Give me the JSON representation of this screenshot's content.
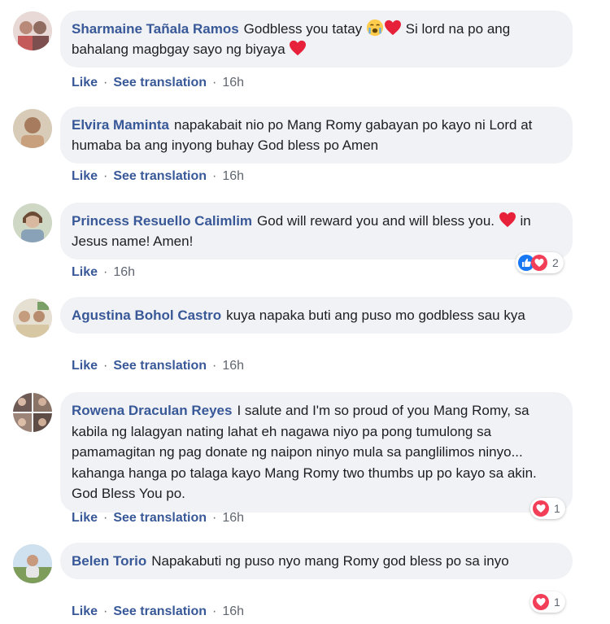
{
  "comments": [
    {
      "author": "Sharmaine Tañala Ramos",
      "text_parts": [
        "Godbless you tatay ",
        " Si lord na po ang bahalang magbgay sayo ng biyaya "
      ],
      "actions": {
        "like": "Like",
        "translate": "See translation",
        "time": "16h"
      }
    },
    {
      "author": "Elvira Maminta",
      "text": "napakabait nio po Mang Romy gabayan po kayo ni Lord at humaba ba ang inyong buhay God bless po Amen",
      "actions": {
        "like": "Like",
        "translate": "See translation",
        "time": "16h"
      }
    },
    {
      "author": "Princess Resuello Calimlim",
      "text_parts": [
        "God will reward you and will bless you. ",
        " in Jesus name! Amen!"
      ],
      "actions": {
        "like": "Like",
        "time": "16h"
      },
      "reaction_count": "2"
    },
    {
      "author": "Agustina Bohol Castro",
      "text": "kuya napaka buti ang puso mo godbless sau kya",
      "actions": {
        "like": "Like",
        "translate": "See translation",
        "time": "16h"
      }
    },
    {
      "author": "Rowena Draculan Reyes",
      "text": "I salute and I'm so proud of you Mang Romy, sa kabila ng lalagyan nating lahat eh nagawa niyo pa pong tumulong sa pamamagitan ng pag donate ng naipon ninyo mula sa panglilimos ninyo... kahanga hanga po talaga kayo Mang Romy two thumbs up po kayo sa akin. God Bless You po.",
      "actions": {
        "like": "Like",
        "translate": "See translation",
        "time": "16h"
      },
      "reaction_count": "1"
    },
    {
      "author": "Belen Torio",
      "text": "Napakabuti ng puso nyo mang Romy god bless po sa inyo",
      "actions": {
        "like": "Like",
        "translate": "See translation",
        "time": "16h"
      },
      "reaction_count": "1"
    }
  ],
  "colors": {
    "author": "#385898",
    "bubble": "#f0f2f5",
    "muted": "#606770",
    "heart": "#f33e58",
    "like": "#1877f2"
  },
  "icons": [
    "crying-face-icon",
    "heart-icon",
    "like-icon",
    "love-icon"
  ]
}
